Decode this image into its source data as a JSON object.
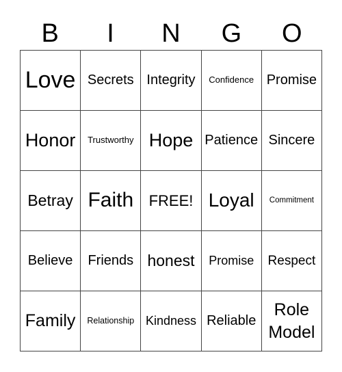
{
  "header": [
    "B",
    "I",
    "N",
    "G",
    "O"
  ],
  "cells": [
    [
      "Love",
      "Secrets",
      "Integrity",
      "Confidence",
      "Promise"
    ],
    [
      "Honor",
      "Trustworthy",
      "Hope",
      "Patience",
      "Sincere"
    ],
    [
      "Betray",
      "Faith",
      "FREE!",
      "Loyal",
      "Commitment"
    ],
    [
      "Believe",
      "Friends",
      "honest",
      "Promise",
      "Respect"
    ],
    [
      "Family",
      "Relationship",
      "Kindness",
      "Reliable",
      "Role Model"
    ]
  ]
}
